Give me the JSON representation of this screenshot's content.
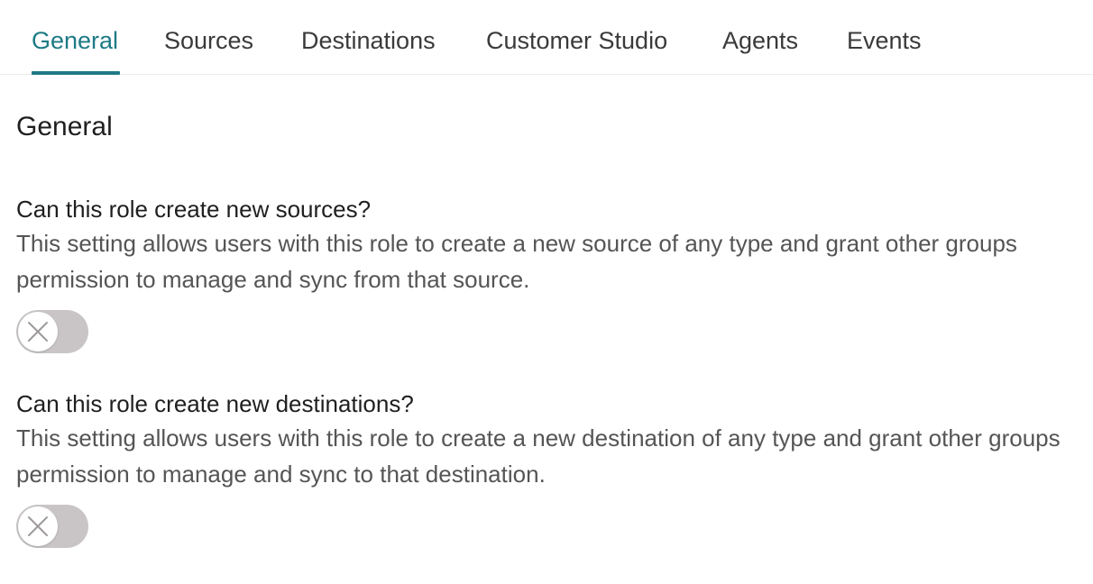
{
  "tabs": [
    {
      "label": "General",
      "active": true
    },
    {
      "label": "Sources",
      "active": false
    },
    {
      "label": "Destinations",
      "active": false
    },
    {
      "label": "Customer Studio",
      "active": false
    },
    {
      "label": "Agents",
      "active": false
    },
    {
      "label": "Events",
      "active": false
    }
  ],
  "section": {
    "title": "General"
  },
  "settings": [
    {
      "title": "Can this role create new sources?",
      "description": "This setting allows users with this role to create a new source of any type and grant other groups permission to manage and sync from that source.",
      "enabled": false
    },
    {
      "title": "Can this role create new destinations?",
      "description": "This setting allows users with this role to create a new destination of any type and grant other groups permission to manage and sync to that destination.",
      "enabled": false
    }
  ],
  "colors": {
    "accent": "#1d7a85",
    "toggle_off": "#c9c5c7"
  },
  "icons": {
    "toggle_off_knob": "close-icon"
  }
}
